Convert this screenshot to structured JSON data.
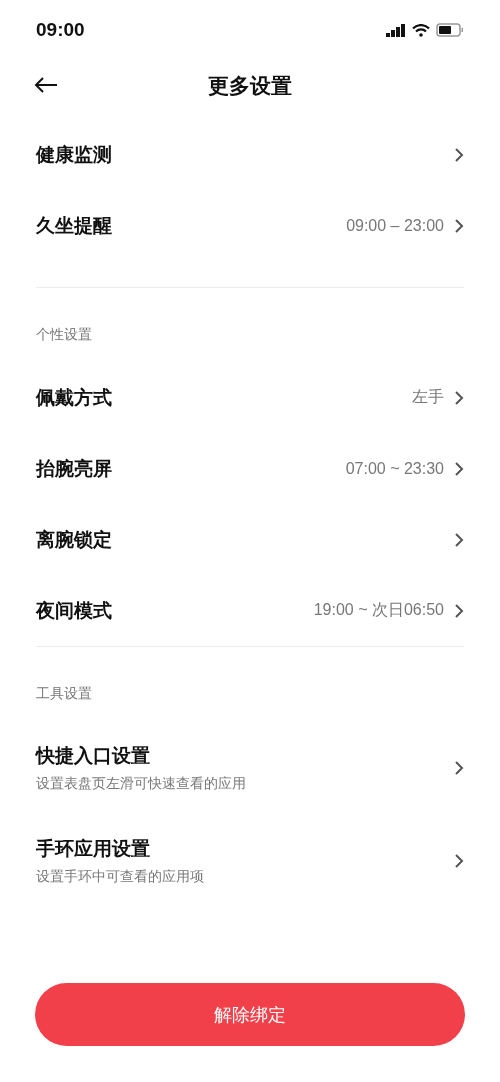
{
  "status_bar": {
    "time": "09:00"
  },
  "header": {
    "title": "更多设置"
  },
  "sections": [
    {
      "items": [
        {
          "title": "健康监测"
        },
        {
          "title": "久坐提醒",
          "value": "09:00 – 23:00"
        }
      ]
    },
    {
      "label": "个性设置",
      "items": [
        {
          "title": "佩戴方式",
          "value": "左手"
        },
        {
          "title": "抬腕亮屏",
          "value": "07:00 ~ 23:30"
        },
        {
          "title": "离腕锁定"
        },
        {
          "title": "夜间模式",
          "value": "19:00 ~ 次日06:50"
        }
      ]
    },
    {
      "label": "工具设置",
      "items": [
        {
          "title": "快捷入口设置",
          "subtitle": "设置表盘页左滑可快速查看的应用"
        },
        {
          "title": "手环应用设置",
          "subtitle": "设置手环中可查看的应用项"
        }
      ]
    }
  ],
  "unbind_button": {
    "label": "解除绑定"
  }
}
